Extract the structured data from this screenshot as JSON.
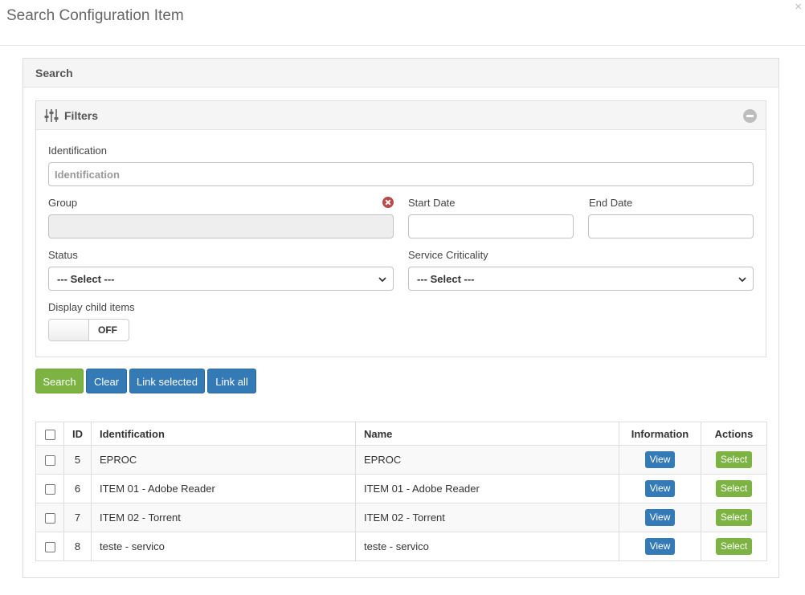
{
  "modal": {
    "title": "Search Configuration Item",
    "close_label": "×"
  },
  "search_panel": {
    "title": "Search"
  },
  "filters": {
    "title": "Filters",
    "identification": {
      "label": "Identification",
      "placeholder": "Identification",
      "value": ""
    },
    "group": {
      "label": "Group",
      "value": ""
    },
    "start_date": {
      "label": "Start Date",
      "value": ""
    },
    "end_date": {
      "label": "End Date",
      "value": ""
    },
    "status": {
      "label": "Status",
      "selected": "--- Select ---"
    },
    "service_criticality": {
      "label": "Service Criticality",
      "selected": "--- Select ---"
    },
    "display_child_items": {
      "label": "Display child items",
      "state": "OFF"
    }
  },
  "actions": {
    "search": "Search",
    "clear": "Clear",
    "link_selected": "Link selected",
    "link_all": "Link all"
  },
  "table": {
    "headers": {
      "id": "ID",
      "identification": "Identification",
      "name": "Name",
      "information": "Information",
      "actions": "Actions"
    },
    "view_label": "View",
    "select_label": "Select",
    "rows": [
      {
        "id": "5",
        "identification": "EPROC",
        "name": "EPROC"
      },
      {
        "id": "6",
        "identification": "ITEM 01 - Adobe Reader",
        "name": "ITEM 01 - Adobe Reader"
      },
      {
        "id": "7",
        "identification": "ITEM 02 - Torrent",
        "name": "ITEM 02 - Torrent"
      },
      {
        "id": "8",
        "identification": "teste - servico",
        "name": "teste - servico"
      }
    ]
  },
  "colors": {
    "primary": "#337ab7",
    "success": "#7cb342",
    "danger": "#b94a48"
  },
  "icons": {
    "filters": "sliders-icon",
    "collapse": "minus-circle-icon",
    "group_clear": "times-circle-icon",
    "select": "chevron-down-icon"
  }
}
